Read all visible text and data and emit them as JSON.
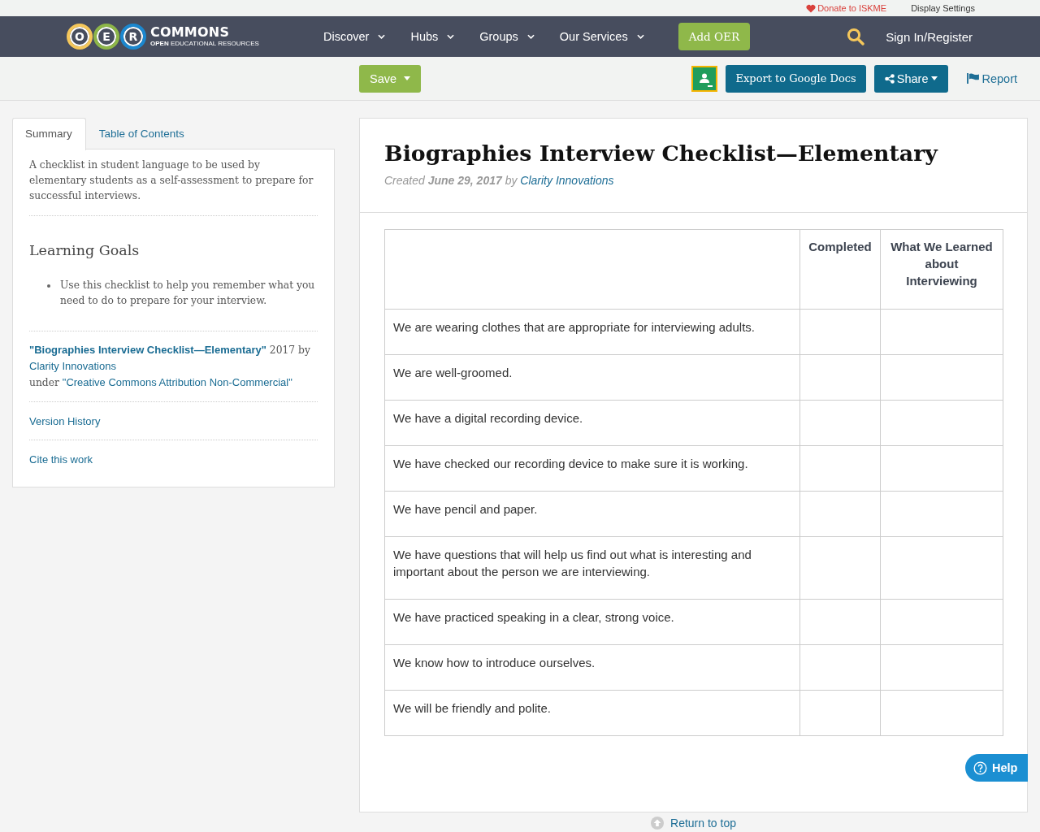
{
  "top_links": [
    {
      "kind": "donate",
      "label": "Donate to ISKME"
    },
    {
      "kind": "plain",
      "label": "Display Settings"
    }
  ],
  "navbar": {
    "logo": {
      "letters": [
        {
          "letter": "O",
          "color": "#f5c75b"
        },
        {
          "letter": "E",
          "color": "#8db648"
        },
        {
          "letter": "R",
          "color": "#1b87cf"
        }
      ],
      "wordmark": "COMMONS",
      "tagline": "**OPEN** EDUCATIONAL RESOURCES"
    },
    "menu": [
      "Discover",
      "Hubs",
      "Groups",
      "Our Services"
    ],
    "add_button": "Add OER",
    "sign_in": "Sign In/Register"
  },
  "toolbar": {
    "save": "Save",
    "export": "Export to Google Docs",
    "share": "Share",
    "report": "Report"
  },
  "sidebar": {
    "tabs": [
      {
        "label": "Summary",
        "selected": true
      },
      {
        "label": "Table of Contents",
        "selected": false
      }
    ],
    "summary": "A checklist in student language to be used by elementary students as a self-assessment to prepare for successful interviews.",
    "goals_heading": "Learning Goals",
    "goals": [
      "Use this checklist to help you remember what you need to do to prepare for your interview."
    ],
    "attribution": {
      "title": "\"Biographies Interview Checklist—Elementary\"",
      "year_by": "2017 by",
      "author": "Clarity Innovations",
      "under": "under",
      "license": "\"Creative Commons Attribution Non-Commercial\""
    },
    "links": [
      "Version History",
      "Cite this work"
    ]
  },
  "resource": {
    "title": "Biographies Interview Checklist—Elementary",
    "created": "Created **June 29, 2017** by",
    "author": "Clarity Innovations"
  },
  "table": {
    "columns": [
      "Completed",
      "What We Learned about Interviewing"
    ],
    "rows": [
      "We are wearing clothes that are appropriate for interviewing adults.",
      "We are well-groomed.",
      "We have a digital recording device.",
      "We have checked our recording device to make sure it is working.",
      "We have pencil and paper.",
      "We have questions that will help us find out what is interesting and important about the person we are interviewing.",
      "We have practiced speaking in a clear, strong voice.",
      "We know how to introduce ourselves.",
      "We will be friendly and polite."
    ]
  },
  "help": "Help",
  "return_to_top": "Return to top"
}
